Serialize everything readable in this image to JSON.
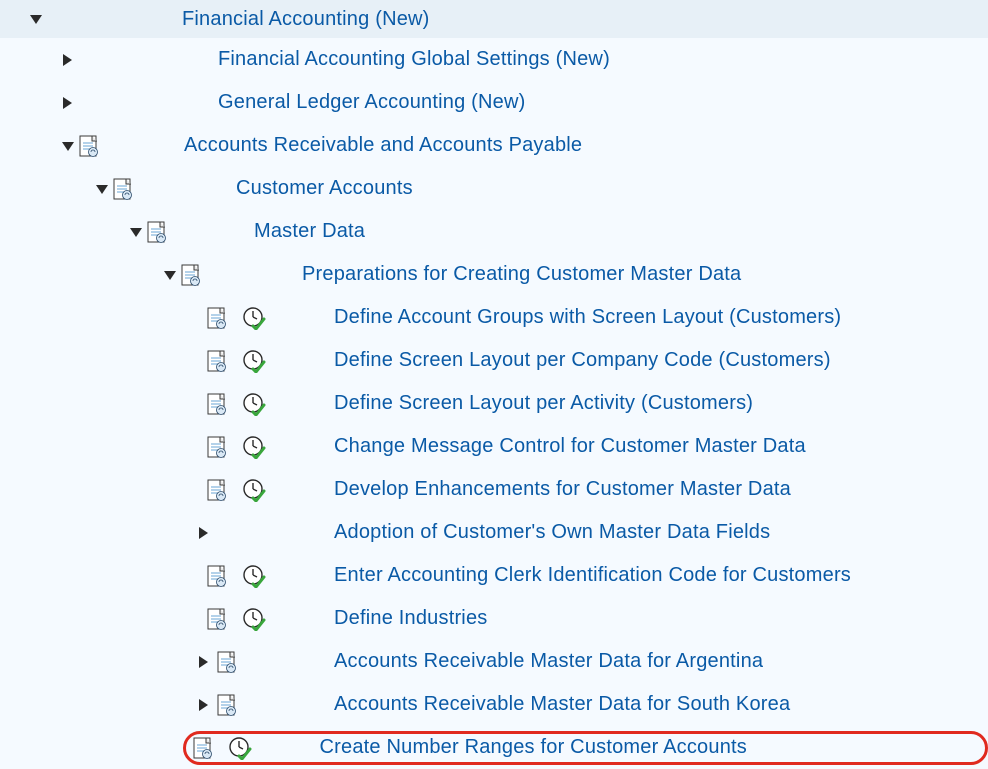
{
  "tree": {
    "root": {
      "label": "Financial Accounting (New)"
    },
    "items": [
      {
        "label": "Financial Accounting Global Settings (New)"
      },
      {
        "label": "General Ledger Accounting (New)"
      },
      {
        "label": "Accounts Receivable and Accounts Payable"
      }
    ],
    "customer_accounts": {
      "label": "Customer Accounts"
    },
    "master_data": {
      "label": "Master Data"
    },
    "preparations": {
      "label": "Preparations for Creating Customer Master Data"
    },
    "leaves": [
      {
        "label": "Define Account Groups with Screen Layout (Customers)"
      },
      {
        "label": "Define Screen Layout per Company Code (Customers)"
      },
      {
        "label": "Define Screen Layout per Activity (Customers)"
      },
      {
        "label": "Change Message Control for Customer Master Data"
      },
      {
        "label": "Develop Enhancements for Customer Master Data"
      },
      {
        "label": "Adoption of Customer's Own Master Data Fields"
      },
      {
        "label": "Enter Accounting Clerk Identification Code for Customers"
      },
      {
        "label": "Define Industries"
      },
      {
        "label": "Accounts Receivable Master Data for Argentina"
      },
      {
        "label": "Accounts Receivable Master Data for South Korea"
      },
      {
        "label": "Create Number Ranges for Customer Accounts"
      }
    ]
  }
}
